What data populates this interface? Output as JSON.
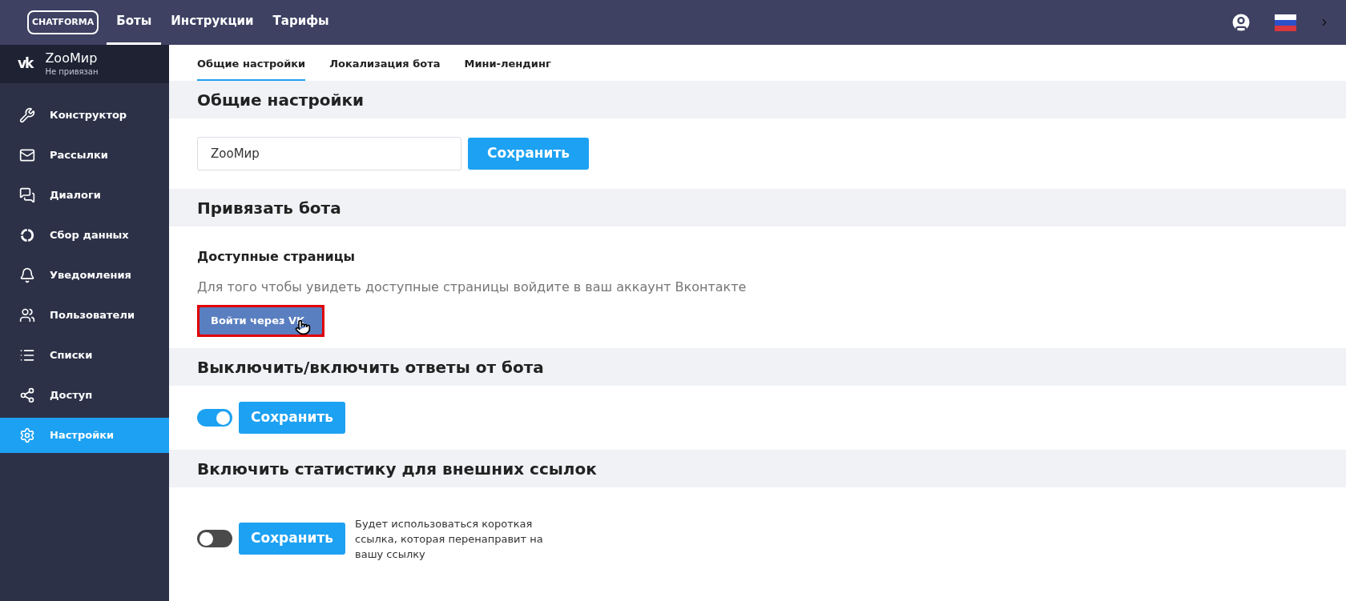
{
  "topbar": {
    "logo": "CHATFORMA",
    "nav": [
      {
        "label": "Боты",
        "selected": true
      },
      {
        "label": "Инструкции",
        "selected": false
      },
      {
        "label": "Тарифы",
        "selected": false
      }
    ]
  },
  "account": {
    "logo": "vk",
    "name": "ZooМир",
    "status": "Не привязан"
  },
  "sidebar": {
    "items": [
      {
        "label": "Конструктор",
        "selected": false
      },
      {
        "label": "Рассылки",
        "selected": false
      },
      {
        "label": "Диалоги",
        "selected": false
      },
      {
        "label": "Сбор данных",
        "selected": false
      },
      {
        "label": "Уведомления",
        "selected": false
      },
      {
        "label": "Пользователи",
        "selected": false
      },
      {
        "label": "Списки",
        "selected": false
      },
      {
        "label": "Доступ",
        "selected": false
      },
      {
        "label": "Настройки",
        "selected": true
      }
    ]
  },
  "tabs": [
    {
      "label": "Общие настройки",
      "selected": true
    },
    {
      "label": "Локализация бота",
      "selected": false
    },
    {
      "label": "Мини-лендинг",
      "selected": false
    }
  ],
  "sections": [
    {
      "kind": "name_field",
      "title": "Общие настройки",
      "value": "ZooМир",
      "button": "Сохранить"
    },
    {
      "kind": "link_account",
      "title": "Привязать бота",
      "subtitle": "Доступные страницы",
      "hint": "Для того чтобы увидеть доступные страницы войдите в ваш аккаунт Вконтакте",
      "button": "Войти через VK",
      "highlighted": true
    },
    {
      "kind": "toggle",
      "title": "Выключить/включить ответы от бота",
      "on": true,
      "button": "Сохранить"
    },
    {
      "kind": "toggle",
      "title": "Включить статистику для внешних ссылок",
      "on": false,
      "button": "Сохранить",
      "note": "Будет использоваться короткая ссылка, которая перенаправит на вашу ссылку"
    }
  ]
}
